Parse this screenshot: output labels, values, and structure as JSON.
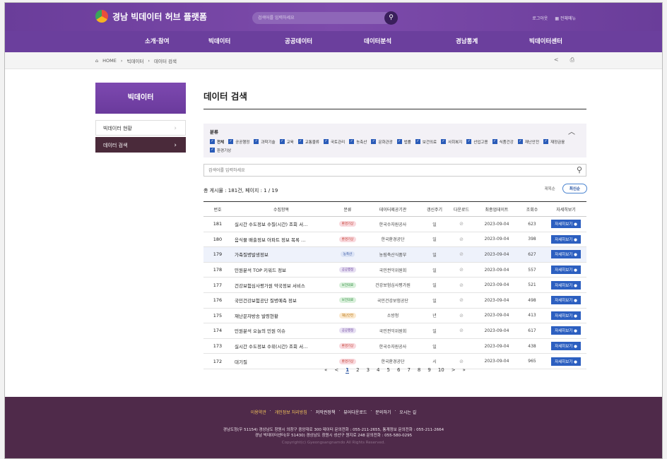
{
  "header": {
    "logo": "경남 빅데이터 허브 플랫폼",
    "search_placeholder": "검색어를 입력하세요",
    "util_logout": "로그아웃",
    "util_menu": "전체메뉴"
  },
  "gnb": [
    "소개·참여",
    "빅데이터",
    "공공데이터",
    "데이터분석",
    "경남통계",
    "빅데이터센터"
  ],
  "breadcrumb": [
    "HOME",
    "빅데이터",
    "데이터 검색"
  ],
  "sidebar": {
    "title": "빅데이터",
    "items": [
      "빅데이터 현황",
      "데이터 검색"
    ]
  },
  "main": {
    "title": "데이터 검색",
    "category_label": "분류",
    "categories": [
      "전체",
      "공공행정",
      "과학기술",
      "교육",
      "교통물류",
      "국토관리",
      "농축산",
      "문화관광",
      "법률",
      "보건의료",
      "사회복지",
      "산업고용",
      "식품건강",
      "재난안전",
      "재정금융",
      "환경기상"
    ],
    "search_placeholder": "검색어를 입력하세요",
    "count_text": "총 게시물 : 181건, 페이지 : 1 / 19",
    "sort": [
      "제목순",
      "최신순"
    ],
    "columns": [
      "번호",
      "수집항목",
      "분류",
      "데이터제공기관",
      "갱신주기",
      "다운로드",
      "최종업데이트",
      "조회수",
      "자세히보기"
    ],
    "detail_label": "자세히보기 ●",
    "rows": [
      {
        "no": "181",
        "title": "실시간 수도정보 수질(시간) 조회 서…",
        "cat": "환경기상",
        "org": "한국수자원공사",
        "cycle": "일",
        "date": "2023-09-04",
        "views": "623"
      },
      {
        "no": "180",
        "title": "음식물 배출정보 아파트 정보 목록 …",
        "cat": "환경기상",
        "org": "한국환경공단",
        "cycle": "일",
        "date": "2023-09-04",
        "views": "398"
      },
      {
        "no": "179",
        "title": "가축질병발생정보",
        "cat": "농축산",
        "org": "농림축산식품부",
        "cycle": "일",
        "date": "2023-09-04",
        "views": "627"
      },
      {
        "no": "178",
        "title": "민원분석 TOP 키워드 정보",
        "cat": "공공행정",
        "org": "국민권익위원회",
        "cycle": "일",
        "date": "2023-09-04",
        "views": "557"
      },
      {
        "no": "177",
        "title": "건강보험심사평가원 약국정보 서비스",
        "cat": "보건의료",
        "org": "건강보험심사평가원",
        "cycle": "일",
        "date": "2023-09-04",
        "views": "521"
      },
      {
        "no": "176",
        "title": "국민건강보험공단 질병예측 정보",
        "cat": "보건의료",
        "org": "국민건강보험공단",
        "cycle": "일",
        "date": "2023-09-04",
        "views": "498"
      },
      {
        "no": "175",
        "title": "재난문자방송 발령현황",
        "cat": "재난안전",
        "org": "소방청",
        "cycle": "년",
        "date": "2023-09-04",
        "views": "413"
      },
      {
        "no": "174",
        "title": "민원분석 오늘의 민원 이슈",
        "cat": "공공행정",
        "org": "국민권익위원회",
        "cycle": "일",
        "date": "2023-09-04",
        "views": "617"
      },
      {
        "no": "173",
        "title": "실시간 수도정보 수위(시간) 조회 서…",
        "cat": "환경기상",
        "org": "한국수자원공사",
        "cycle": "일",
        "date": "2023-09-04",
        "views": "438"
      },
      {
        "no": "172",
        "title": "대기질",
        "cat": "환경기상",
        "org": "한국환경공단",
        "cycle": "시",
        "date": "2023-09-04",
        "views": "965"
      }
    ],
    "pager": [
      "«",
      "<",
      "1",
      "2",
      "3",
      "4",
      "5",
      "6",
      "7",
      "8",
      "9",
      "10",
      ">",
      "»"
    ]
  },
  "footer": {
    "links": [
      "이용약관",
      "개인정보 처리방침",
      "저작권정책",
      "뷰어다운로드",
      "문의하기",
      "오시는 길"
    ],
    "addr1": "경남도청(우 51154) 경상남도 창원시 의창구 중앙대로 300 데이터 문의전화 : 055-211-2655, 통계정보 문의전화 : 055-211-2664",
    "addr2": "경남 빅데이터센터(우 51430) 경상남도 창원시 성산구 원지로 248 문의전화 : 055-580-0295",
    "copyright": "Copyright(c) Gyeongsangnamdo All Rights Reserved."
  }
}
